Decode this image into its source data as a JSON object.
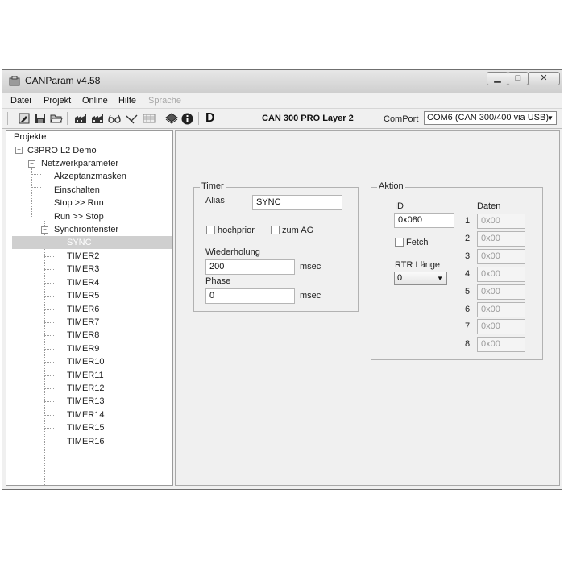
{
  "window": {
    "title": "CANParam v4.58",
    "buttons": {
      "minimize": "▁",
      "maximize": "□",
      "close": "✕"
    }
  },
  "menu": {
    "items": [
      {
        "label": "Datei",
        "enabled": true
      },
      {
        "label": "Projekt",
        "enabled": true
      },
      {
        "label": "Online",
        "enabled": true
      },
      {
        "label": "Hilfe",
        "enabled": true
      },
      {
        "label": "Sprache",
        "enabled": false
      }
    ]
  },
  "toolbar": {
    "icons": [
      "pin-icon",
      "save-icon",
      "open-folder-icon",
      "factory-icon",
      "factory-alt-icon",
      "glasses-icon",
      "link-icon",
      "table-icon",
      "book-icon",
      "info-icon"
    ],
    "d_label": "D",
    "device_title": "CAN 300 PRO Layer 2",
    "comport_label": "ComPort",
    "comport_value": "COM6 (CAN 300/400 via USB)"
  },
  "tree": {
    "header": "Projekte",
    "root": "C3PRO L2 Demo",
    "group": "Netzwerkparameter",
    "children": [
      "Akzeptanzmasken",
      "Einschalten",
      "Stop >> Run",
      "Run >> Stop"
    ],
    "sync_group": "Synchronfenster",
    "selected": "SYNC",
    "timers": [
      "TIMER2",
      "TIMER3",
      "TIMER4",
      "TIMER5",
      "TIMER6",
      "TIMER7",
      "TIMER8",
      "TIMER9",
      "TIMER10",
      "TIMER11",
      "TIMER12",
      "TIMER13",
      "TIMER14",
      "TIMER15",
      "TIMER16"
    ]
  },
  "timer": {
    "group_label": "Timer",
    "alias_label": "Alias",
    "alias_value": "SYNC",
    "hochprior_label": "hochprior",
    "hochprior_checked": false,
    "zum_ag_label": "zum AG",
    "zum_ag_checked": false,
    "wiederholung_label": "Wiederholung",
    "wiederholung_value": "200",
    "wiederholung_unit": "msec",
    "phase_label": "Phase",
    "phase_value": "0",
    "phase_unit": "msec"
  },
  "aktion": {
    "group_label": "Aktion",
    "id_label": "ID",
    "id_value": "0x080",
    "fetch_label": "Fetch",
    "fetch_checked": false,
    "rtr_label": "RTR Länge",
    "rtr_value": "0",
    "daten_label": "Daten",
    "daten_rows": [
      {
        "index": "1",
        "value": "0x00"
      },
      {
        "index": "2",
        "value": "0x00"
      },
      {
        "index": "3",
        "value": "0x00"
      },
      {
        "index": "4",
        "value": "0x00"
      },
      {
        "index": "5",
        "value": "0x00"
      },
      {
        "index": "6",
        "value": "0x00"
      },
      {
        "index": "7",
        "value": "0x00"
      },
      {
        "index": "8",
        "value": "0x00"
      }
    ]
  }
}
